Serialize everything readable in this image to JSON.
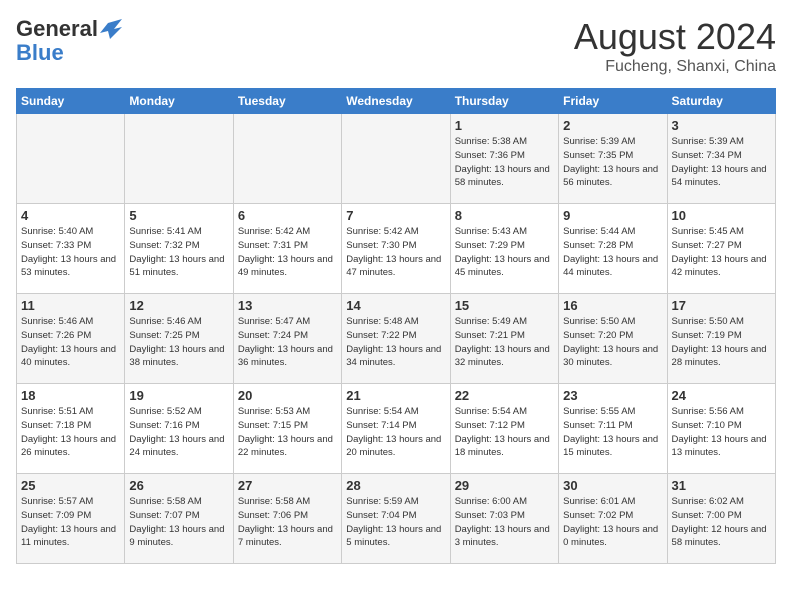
{
  "header": {
    "logo_general": "General",
    "logo_blue": "Blue",
    "month_year": "August 2024",
    "location": "Fucheng, Shanxi, China"
  },
  "weekdays": [
    "Sunday",
    "Monday",
    "Tuesday",
    "Wednesday",
    "Thursday",
    "Friday",
    "Saturday"
  ],
  "rows": [
    [
      {
        "day": "",
        "empty": true
      },
      {
        "day": "",
        "empty": true
      },
      {
        "day": "",
        "empty": true
      },
      {
        "day": "",
        "empty": true
      },
      {
        "day": "1",
        "sunrise": "5:38 AM",
        "sunset": "7:36 PM",
        "daylight": "13 hours and 58 minutes."
      },
      {
        "day": "2",
        "sunrise": "5:39 AM",
        "sunset": "7:35 PM",
        "daylight": "13 hours and 56 minutes."
      },
      {
        "day": "3",
        "sunrise": "5:39 AM",
        "sunset": "7:34 PM",
        "daylight": "13 hours and 54 minutes."
      }
    ],
    [
      {
        "day": "4",
        "sunrise": "5:40 AM",
        "sunset": "7:33 PM",
        "daylight": "13 hours and 53 minutes."
      },
      {
        "day": "5",
        "sunrise": "5:41 AM",
        "sunset": "7:32 PM",
        "daylight": "13 hours and 51 minutes."
      },
      {
        "day": "6",
        "sunrise": "5:42 AM",
        "sunset": "7:31 PM",
        "daylight": "13 hours and 49 minutes."
      },
      {
        "day": "7",
        "sunrise": "5:42 AM",
        "sunset": "7:30 PM",
        "daylight": "13 hours and 47 minutes."
      },
      {
        "day": "8",
        "sunrise": "5:43 AM",
        "sunset": "7:29 PM",
        "daylight": "13 hours and 45 minutes."
      },
      {
        "day": "9",
        "sunrise": "5:44 AM",
        "sunset": "7:28 PM",
        "daylight": "13 hours and 44 minutes."
      },
      {
        "day": "10",
        "sunrise": "5:45 AM",
        "sunset": "7:27 PM",
        "daylight": "13 hours and 42 minutes."
      }
    ],
    [
      {
        "day": "11",
        "sunrise": "5:46 AM",
        "sunset": "7:26 PM",
        "daylight": "13 hours and 40 minutes."
      },
      {
        "day": "12",
        "sunrise": "5:46 AM",
        "sunset": "7:25 PM",
        "daylight": "13 hours and 38 minutes."
      },
      {
        "day": "13",
        "sunrise": "5:47 AM",
        "sunset": "7:24 PM",
        "daylight": "13 hours and 36 minutes."
      },
      {
        "day": "14",
        "sunrise": "5:48 AM",
        "sunset": "7:22 PM",
        "daylight": "13 hours and 34 minutes."
      },
      {
        "day": "15",
        "sunrise": "5:49 AM",
        "sunset": "7:21 PM",
        "daylight": "13 hours and 32 minutes."
      },
      {
        "day": "16",
        "sunrise": "5:50 AM",
        "sunset": "7:20 PM",
        "daylight": "13 hours and 30 minutes."
      },
      {
        "day": "17",
        "sunrise": "5:50 AM",
        "sunset": "7:19 PM",
        "daylight": "13 hours and 28 minutes."
      }
    ],
    [
      {
        "day": "18",
        "sunrise": "5:51 AM",
        "sunset": "7:18 PM",
        "daylight": "13 hours and 26 minutes."
      },
      {
        "day": "19",
        "sunrise": "5:52 AM",
        "sunset": "7:16 PM",
        "daylight": "13 hours and 24 minutes."
      },
      {
        "day": "20",
        "sunrise": "5:53 AM",
        "sunset": "7:15 PM",
        "daylight": "13 hours and 22 minutes."
      },
      {
        "day": "21",
        "sunrise": "5:54 AM",
        "sunset": "7:14 PM",
        "daylight": "13 hours and 20 minutes."
      },
      {
        "day": "22",
        "sunrise": "5:54 AM",
        "sunset": "7:12 PM",
        "daylight": "13 hours and 18 minutes."
      },
      {
        "day": "23",
        "sunrise": "5:55 AM",
        "sunset": "7:11 PM",
        "daylight": "13 hours and 15 minutes."
      },
      {
        "day": "24",
        "sunrise": "5:56 AM",
        "sunset": "7:10 PM",
        "daylight": "13 hours and 13 minutes."
      }
    ],
    [
      {
        "day": "25",
        "sunrise": "5:57 AM",
        "sunset": "7:09 PM",
        "daylight": "13 hours and 11 minutes."
      },
      {
        "day": "26",
        "sunrise": "5:58 AM",
        "sunset": "7:07 PM",
        "daylight": "13 hours and 9 minutes."
      },
      {
        "day": "27",
        "sunrise": "5:58 AM",
        "sunset": "7:06 PM",
        "daylight": "13 hours and 7 minutes."
      },
      {
        "day": "28",
        "sunrise": "5:59 AM",
        "sunset": "7:04 PM",
        "daylight": "13 hours and 5 minutes."
      },
      {
        "day": "29",
        "sunrise": "6:00 AM",
        "sunset": "7:03 PM",
        "daylight": "13 hours and 3 minutes."
      },
      {
        "day": "30",
        "sunrise": "6:01 AM",
        "sunset": "7:02 PM",
        "daylight": "13 hours and 0 minutes."
      },
      {
        "day": "31",
        "sunrise": "6:02 AM",
        "sunset": "7:00 PM",
        "daylight": "12 hours and 58 minutes."
      }
    ]
  ]
}
